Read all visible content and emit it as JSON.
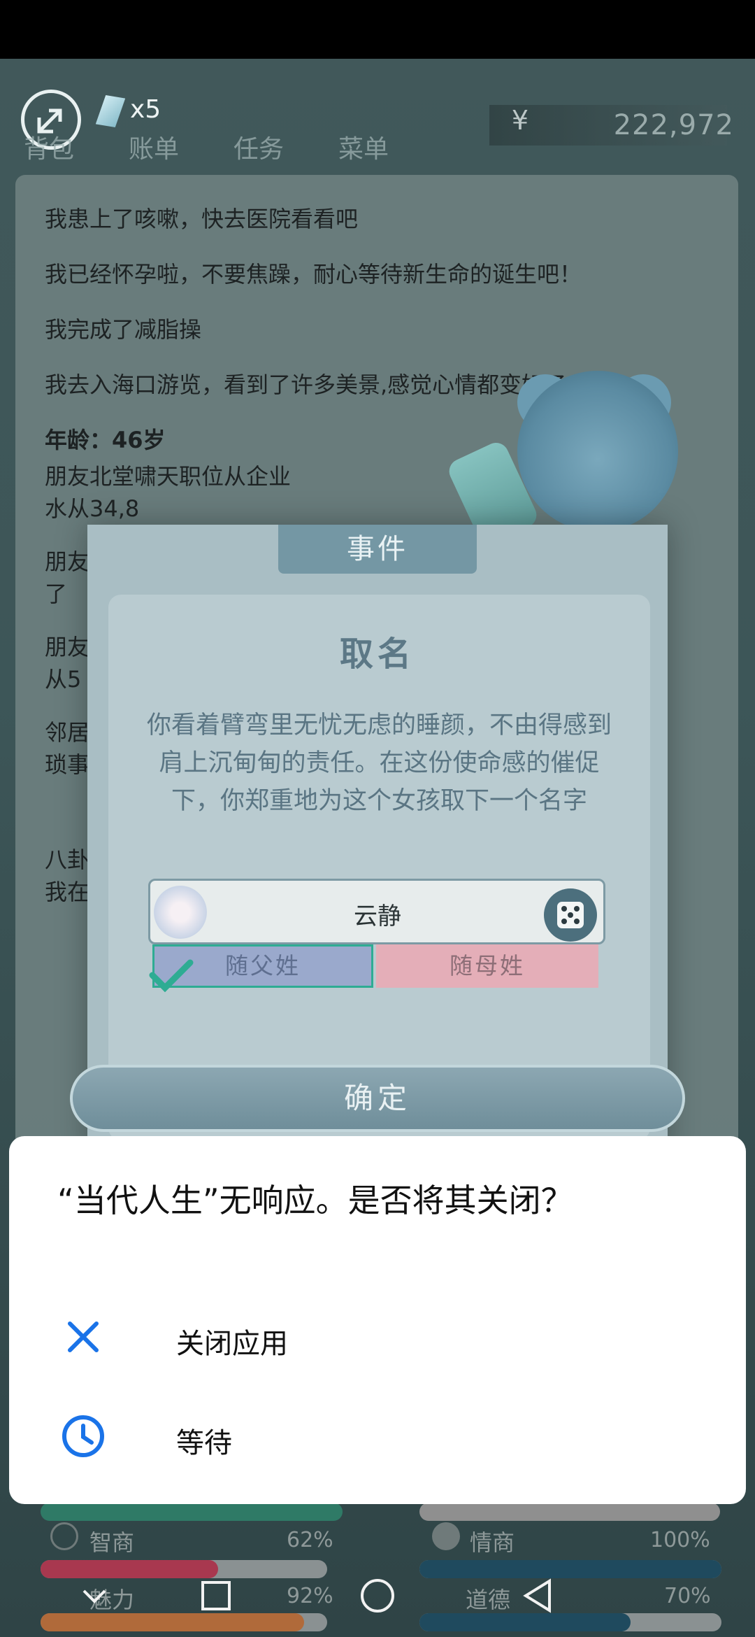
{
  "topbar": {
    "crystal_count": "x5",
    "tabs": [
      "背包",
      "账单",
      "任务",
      "菜单"
    ],
    "currency_symbol": "¥",
    "money": "222,972"
  },
  "log": {
    "lines": [
      "我患上了咳嗽，快去医院看看吧",
      "我已经怀孕啦，不要焦躁，耐心等待新生命的诞生吧！",
      "我完成了减脂操",
      "我去入海口游览，看到了许多美景,感觉心情都变好了"
    ],
    "age": "年龄：46岁",
    "partial1": "朋友北堂啸天职位从企业",
    "partial2": "水从34,8",
    "partial3": "朋友",
    "partial4": "了",
    "partial5": "朋友",
    "partial6": "从5",
    "partial7": "邻居",
    "partial8": "琐事",
    "partial9": "八卦",
    "partial10": "我在"
  },
  "event": {
    "tab_label": "事件",
    "title": "取名",
    "description": "你看着臂弯里无忧无虑的睡颜，不由得感到肩上沉甸甸的责任。在这份使命感的催促下，你郑重地为这个女孩取下一个名字",
    "name_value": "云静",
    "father_surname": "随父姓",
    "mother_surname": "随母姓",
    "confirm_label": "确定"
  },
  "stats": {
    "iq_label": "智商",
    "iq_pct": "62%",
    "eq_label": "情商",
    "eq_pct": "100%",
    "charm_label": "魅力",
    "charm_pct": "92%",
    "moral_label": "道德",
    "moral_pct": "70%"
  },
  "dialog": {
    "title": "“当代人生”无响应。是否将其关闭？",
    "close_label": "关闭应用",
    "wait_label": "等待"
  },
  "colors": {
    "accent_blue": "#1a73e8",
    "check_green": "#2eac93"
  }
}
